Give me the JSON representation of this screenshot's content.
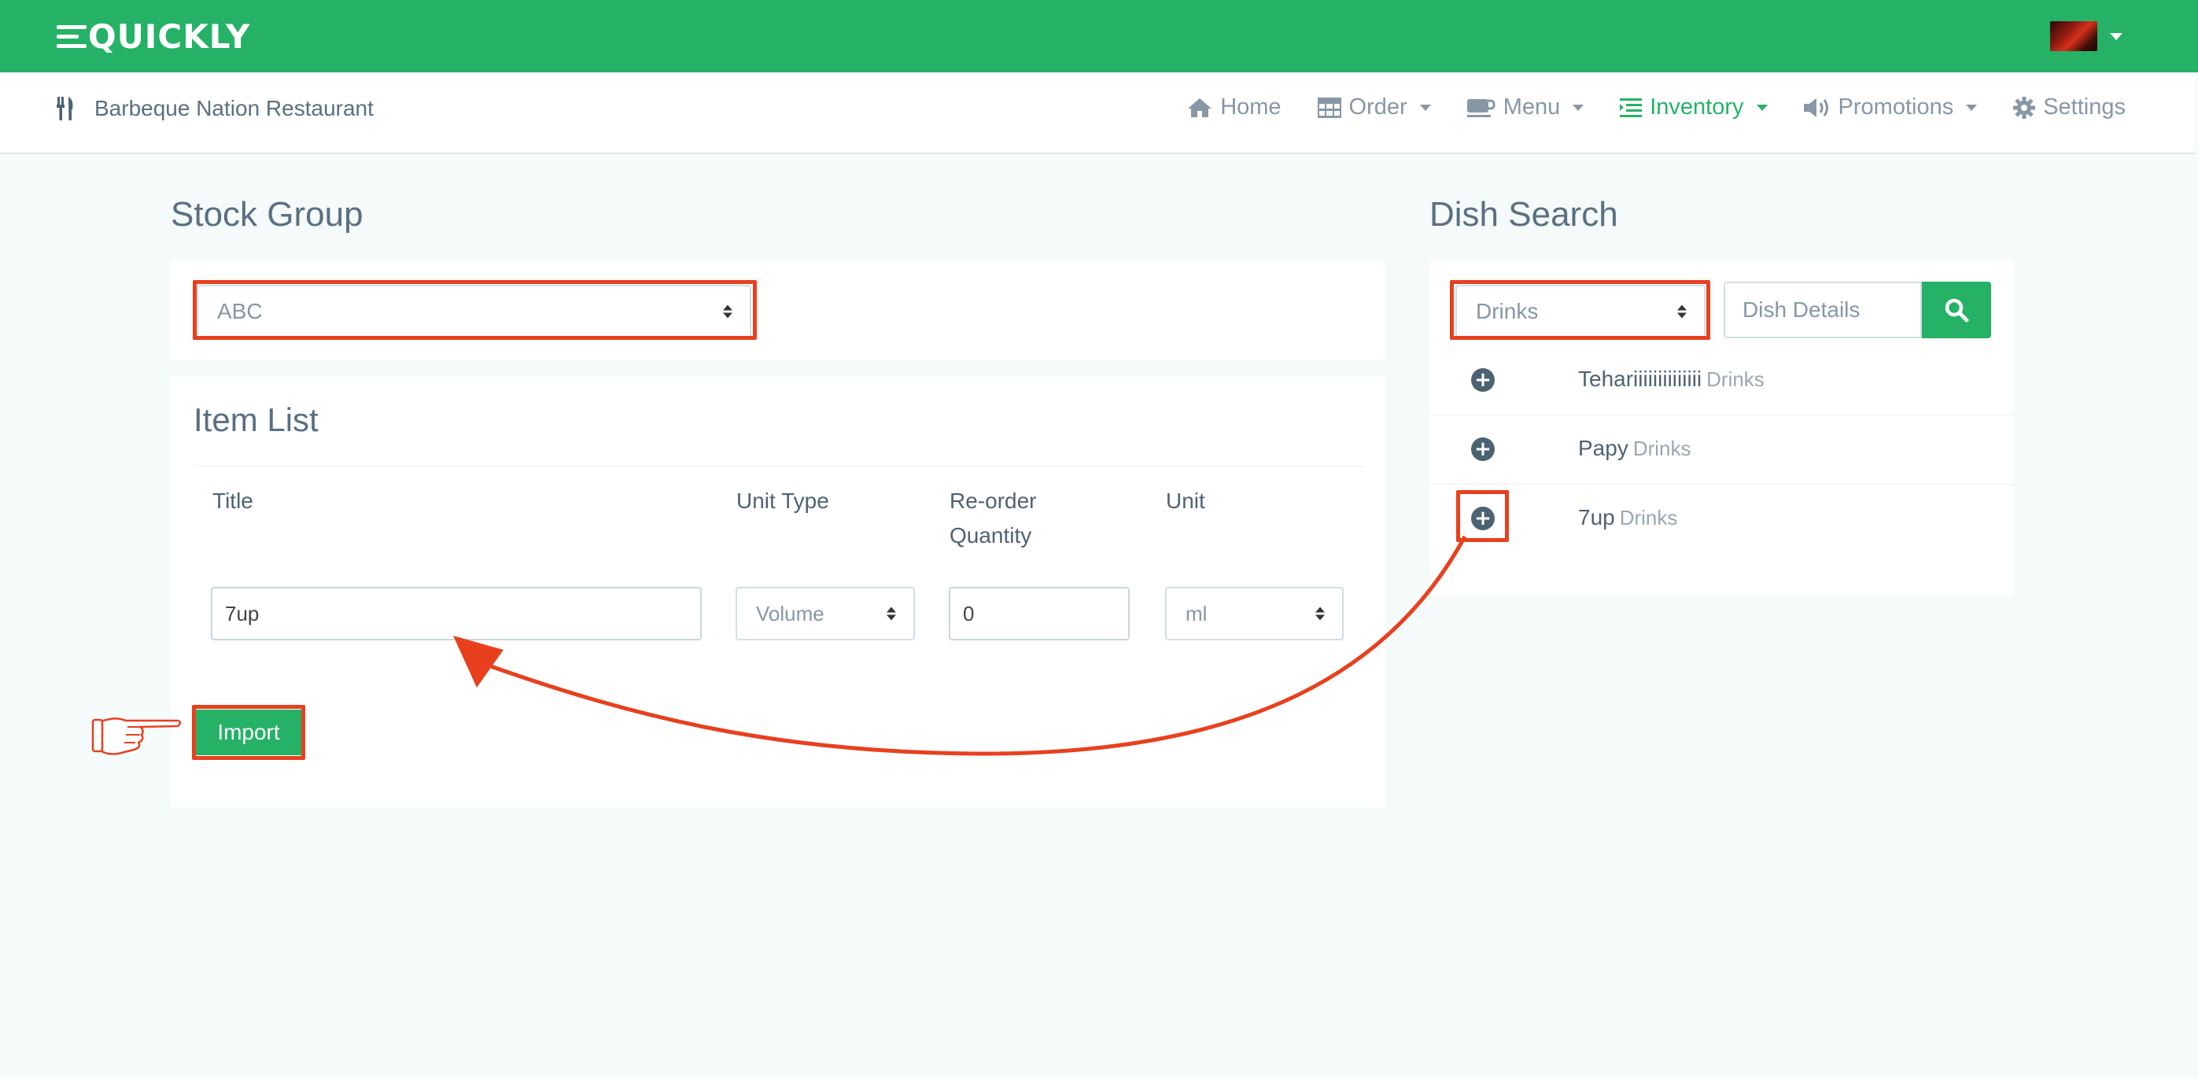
{
  "header": {
    "logo_text": "QUICKLY",
    "restaurant_name": "Barbeque Nation Restaurant"
  },
  "nav": {
    "home": "Home",
    "order": "Order",
    "menu": "Menu",
    "inventory": "Inventory",
    "promotions": "Promotions",
    "settings": "Settings"
  },
  "stock_group": {
    "title": "Stock Group",
    "selected": "ABC"
  },
  "item_list": {
    "title": "Item List",
    "columns": {
      "title": "Title",
      "unit_type": "Unit Type",
      "reorder": "Re-order",
      "reorder_2": "Quantity",
      "unit": "Unit"
    },
    "row": {
      "title": "7up",
      "unit_type": "Volume",
      "reorder_qty": "0",
      "unit": "ml"
    },
    "import_label": "Import"
  },
  "dish_search": {
    "title": "Dish Search",
    "category_selected": "Drinks",
    "search_placeholder": "Dish Details",
    "results": [
      {
        "name": "Tehariiiiiiiiiiiiii",
        "category": "Drinks"
      },
      {
        "name": "Papy",
        "category": "Drinks"
      },
      {
        "name": "7up",
        "category": "Drinks"
      }
    ]
  },
  "colors": {
    "brand_green": "#25b266",
    "annotation_red": "#e8401f"
  }
}
